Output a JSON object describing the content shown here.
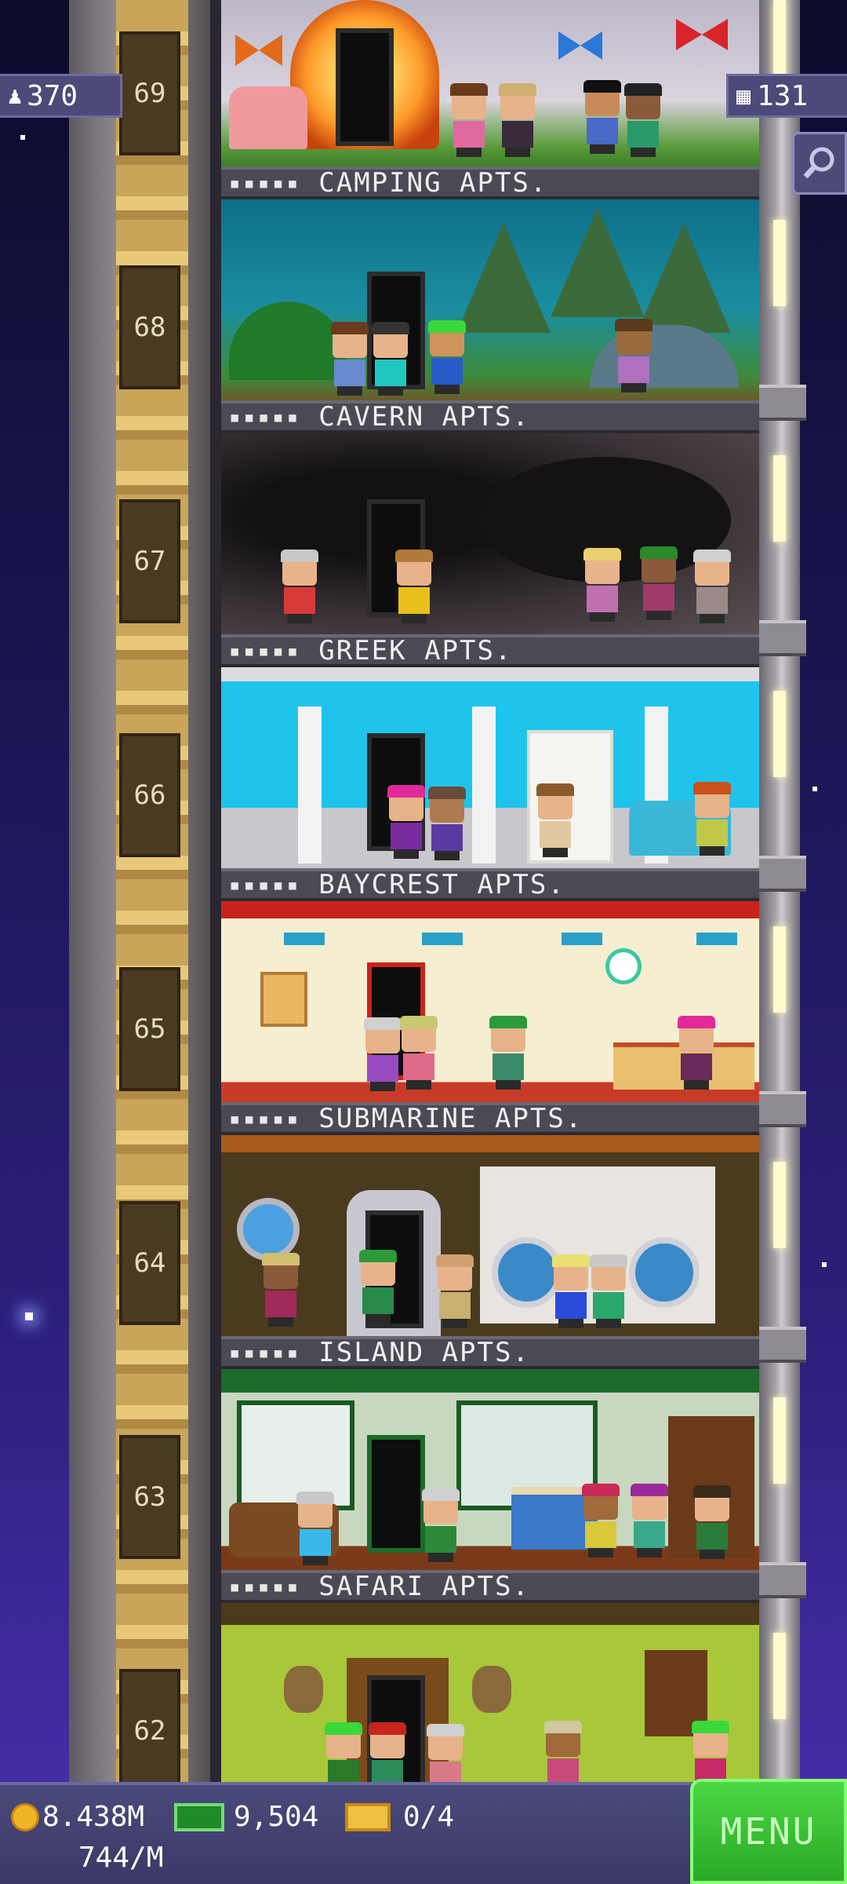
{
  "top_bar": {
    "population": "370",
    "floor_count": "131"
  },
  "floors": [
    {
      "number": "69",
      "name": "",
      "theme": "butterfly"
    },
    {
      "number": "68",
      "name": "CAMPING APTS.",
      "theme": "camping"
    },
    {
      "number": "67",
      "name": "CAVERN APTS.",
      "theme": "cavern"
    },
    {
      "number": "66",
      "name": "GREEK APTS.",
      "theme": "greek"
    },
    {
      "number": "65",
      "name": "BAYCREST APTS.",
      "theme": "baycrest"
    },
    {
      "number": "64",
      "name": "SUBMARINE APTS.",
      "theme": "submarine"
    },
    {
      "number": "63",
      "name": "ISLAND APTS.",
      "theme": "island"
    },
    {
      "number": "62",
      "name": "SAFARI APTS.",
      "theme": "safari"
    }
  ],
  "floor_stars": "▪▪▪▪▪",
  "bottom_bar": {
    "coins": "8.438M",
    "coins_rate": "744/M",
    "bux": "9,504",
    "tickets": "0/4",
    "menu_label": "MENU"
  },
  "icons": {
    "population": "person-icon",
    "floors": "building-icon",
    "search": "magnifier-icon",
    "coins": "coin-icon",
    "bux": "cash-icon",
    "tickets": "ticket-icon"
  },
  "colors": {
    "menu_green": "#2aa827",
    "sky_top": "#0d0b2a",
    "sky_bottom": "#4a2fb0"
  }
}
